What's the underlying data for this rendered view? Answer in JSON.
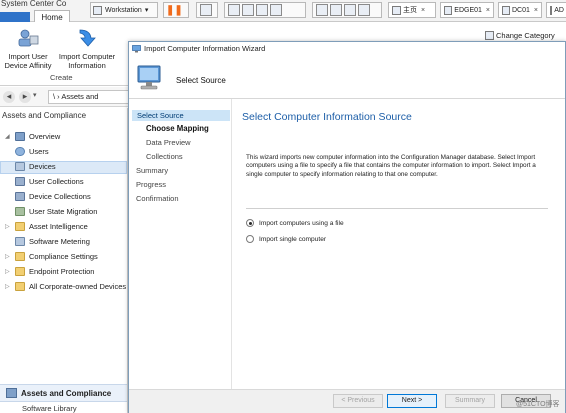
{
  "host": {
    "app_title": "System Center Co",
    "home_tab": "Home",
    "workstation_label": "Workstation",
    "vm_tabs": [
      {
        "label": "主页"
      },
      {
        "label": "EDGE01"
      },
      {
        "label": "DC01"
      },
      {
        "label": "AD"
      }
    ]
  },
  "ribbon": {
    "buttons": [
      {
        "label_line1": "Import User",
        "label_line2": "Device Affinity"
      },
      {
        "label_line1": "Import Computer",
        "label_line2": "Information"
      }
    ],
    "group_label": "Create",
    "change_category": "Change Category"
  },
  "address": {
    "path": "\\  ›  Assets and"
  },
  "nav": {
    "header": "Assets and Compliance",
    "items": [
      {
        "label": "Overview",
        "icon": "overview-icon"
      },
      {
        "label": "Users",
        "icon": "users-icon"
      },
      {
        "label": "Devices",
        "icon": "devices-icon"
      },
      {
        "label": "User Collections",
        "icon": "user-collections-icon"
      },
      {
        "label": "Device Collections",
        "icon": "device-collections-icon"
      },
      {
        "label": "User State Migration",
        "icon": "user-state-migration-icon"
      },
      {
        "label": "Asset Intelligence",
        "icon": "folder-icon"
      },
      {
        "label": "Software Metering",
        "icon": "software-metering-icon"
      },
      {
        "label": "Compliance Settings",
        "icon": "folder-icon"
      },
      {
        "label": "Endpoint Protection",
        "icon": "folder-icon"
      },
      {
        "label": "All Corporate-owned Devices",
        "icon": "folder-icon"
      }
    ],
    "bottom_workspace": "Assets and Compliance",
    "bottom_next": "Software Library"
  },
  "wizard": {
    "title": "Import Computer Information Wizard",
    "header_title": "Select Source",
    "steps": {
      "select_source": "Select Source",
      "choose_mapping": "Choose Mapping",
      "data_preview": "Data Preview",
      "collections": "Collections",
      "summary": "Summary",
      "progress": "Progress",
      "confirmation": "Confirmation"
    },
    "content_title": "Select Computer Information Source",
    "description": "This wizard imports new computer information into the Configuration Manager database. Select Import computers using a file to specify a file that contains the computer information to import. Select Import a single computer to specify information relating to that one computer.",
    "options": [
      {
        "label": "Import computers using a file",
        "selected": true
      },
      {
        "label": "Import single computer",
        "selected": false
      }
    ],
    "buttons": {
      "previous": "< Previous",
      "next": "Next >",
      "summary": "Summary",
      "cancel": "Cancel"
    }
  },
  "watermark": "@51CTO博客"
}
